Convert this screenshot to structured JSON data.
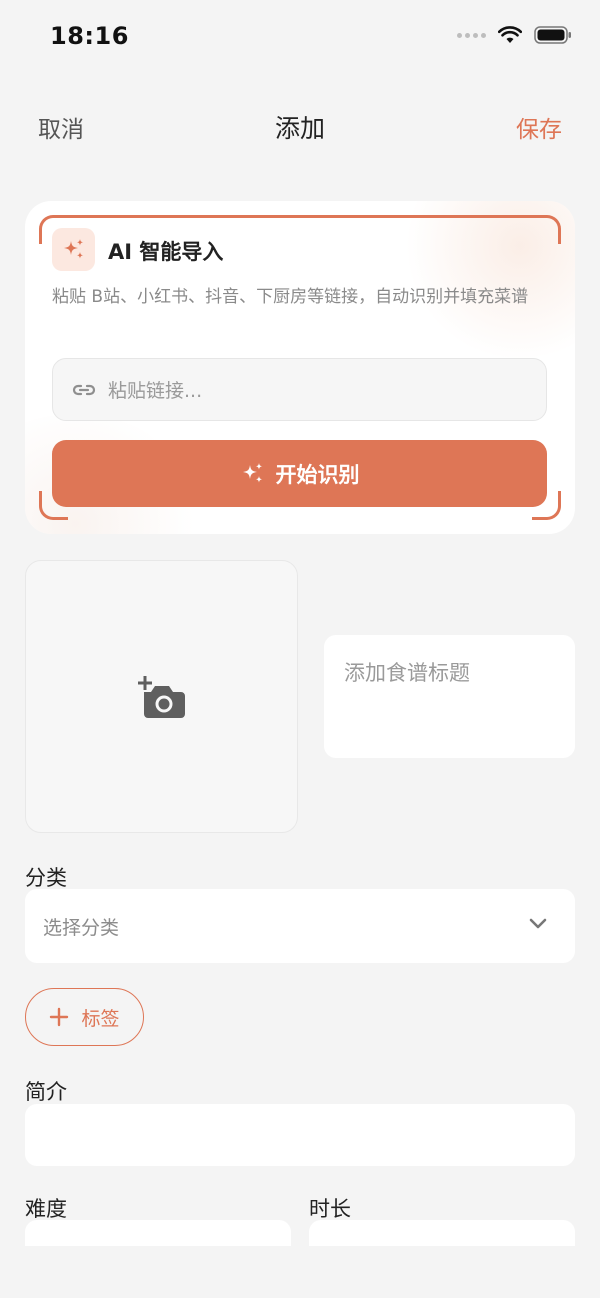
{
  "status_bar": {
    "time": "18:16"
  },
  "nav": {
    "cancel": "取消",
    "title": "添加",
    "save": "保存"
  },
  "ai_import": {
    "title": "AI 智能导入",
    "description": "粘贴 B站、小红书、抖音、下厨房等链接，自动识别并填充菜谱",
    "link_placeholder": "粘贴链接...",
    "button_label": "开始识别"
  },
  "recipe": {
    "title_placeholder": "添加食谱标题",
    "category_label": "分类",
    "category_placeholder": "选择分类",
    "tag_button_label": "标签",
    "intro_label": "简介",
    "difficulty_label": "难度",
    "duration_label": "时长"
  },
  "colors": {
    "accent": "#de7656",
    "background": "#f4f4f4",
    "card": "#ffffff"
  },
  "icons": [
    "sparkle-icon",
    "link-icon",
    "add-photo-icon",
    "chevron-down-icon",
    "plus-icon",
    "wifi-icon",
    "battery-icon"
  ]
}
